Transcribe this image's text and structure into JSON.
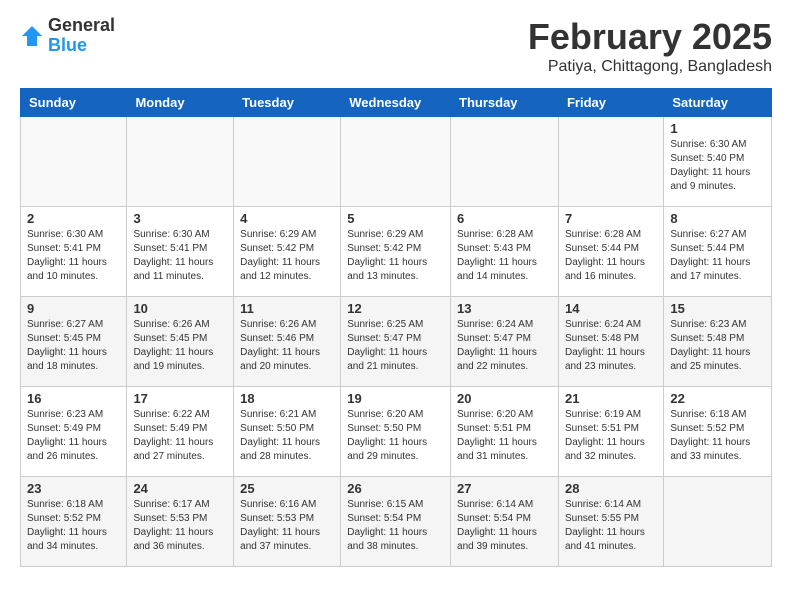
{
  "logo": {
    "general": "General",
    "blue": "Blue"
  },
  "title": "February 2025",
  "subtitle": "Patiya, Chittagong, Bangladesh",
  "days_of_week": [
    "Sunday",
    "Monday",
    "Tuesday",
    "Wednesday",
    "Thursday",
    "Friday",
    "Saturday"
  ],
  "weeks": [
    [
      {
        "day": "",
        "info": ""
      },
      {
        "day": "",
        "info": ""
      },
      {
        "day": "",
        "info": ""
      },
      {
        "day": "",
        "info": ""
      },
      {
        "day": "",
        "info": ""
      },
      {
        "day": "",
        "info": ""
      },
      {
        "day": "1",
        "info": "Sunrise: 6:30 AM\nSunset: 5:40 PM\nDaylight: 11 hours\nand 9 minutes."
      }
    ],
    [
      {
        "day": "2",
        "info": "Sunrise: 6:30 AM\nSunset: 5:41 PM\nDaylight: 11 hours\nand 10 minutes."
      },
      {
        "day": "3",
        "info": "Sunrise: 6:30 AM\nSunset: 5:41 PM\nDaylight: 11 hours\nand 11 minutes."
      },
      {
        "day": "4",
        "info": "Sunrise: 6:29 AM\nSunset: 5:42 PM\nDaylight: 11 hours\nand 12 minutes."
      },
      {
        "day": "5",
        "info": "Sunrise: 6:29 AM\nSunset: 5:42 PM\nDaylight: 11 hours\nand 13 minutes."
      },
      {
        "day": "6",
        "info": "Sunrise: 6:28 AM\nSunset: 5:43 PM\nDaylight: 11 hours\nand 14 minutes."
      },
      {
        "day": "7",
        "info": "Sunrise: 6:28 AM\nSunset: 5:44 PM\nDaylight: 11 hours\nand 16 minutes."
      },
      {
        "day": "8",
        "info": "Sunrise: 6:27 AM\nSunset: 5:44 PM\nDaylight: 11 hours\nand 17 minutes."
      }
    ],
    [
      {
        "day": "9",
        "info": "Sunrise: 6:27 AM\nSunset: 5:45 PM\nDaylight: 11 hours\nand 18 minutes."
      },
      {
        "day": "10",
        "info": "Sunrise: 6:26 AM\nSunset: 5:45 PM\nDaylight: 11 hours\nand 19 minutes."
      },
      {
        "day": "11",
        "info": "Sunrise: 6:26 AM\nSunset: 5:46 PM\nDaylight: 11 hours\nand 20 minutes."
      },
      {
        "day": "12",
        "info": "Sunrise: 6:25 AM\nSunset: 5:47 PM\nDaylight: 11 hours\nand 21 minutes."
      },
      {
        "day": "13",
        "info": "Sunrise: 6:24 AM\nSunset: 5:47 PM\nDaylight: 11 hours\nand 22 minutes."
      },
      {
        "day": "14",
        "info": "Sunrise: 6:24 AM\nSunset: 5:48 PM\nDaylight: 11 hours\nand 23 minutes."
      },
      {
        "day": "15",
        "info": "Sunrise: 6:23 AM\nSunset: 5:48 PM\nDaylight: 11 hours\nand 25 minutes."
      }
    ],
    [
      {
        "day": "16",
        "info": "Sunrise: 6:23 AM\nSunset: 5:49 PM\nDaylight: 11 hours\nand 26 minutes."
      },
      {
        "day": "17",
        "info": "Sunrise: 6:22 AM\nSunset: 5:49 PM\nDaylight: 11 hours\nand 27 minutes."
      },
      {
        "day": "18",
        "info": "Sunrise: 6:21 AM\nSunset: 5:50 PM\nDaylight: 11 hours\nand 28 minutes."
      },
      {
        "day": "19",
        "info": "Sunrise: 6:20 AM\nSunset: 5:50 PM\nDaylight: 11 hours\nand 29 minutes."
      },
      {
        "day": "20",
        "info": "Sunrise: 6:20 AM\nSunset: 5:51 PM\nDaylight: 11 hours\nand 31 minutes."
      },
      {
        "day": "21",
        "info": "Sunrise: 6:19 AM\nSunset: 5:51 PM\nDaylight: 11 hours\nand 32 minutes."
      },
      {
        "day": "22",
        "info": "Sunrise: 6:18 AM\nSunset: 5:52 PM\nDaylight: 11 hours\nand 33 minutes."
      }
    ],
    [
      {
        "day": "23",
        "info": "Sunrise: 6:18 AM\nSunset: 5:52 PM\nDaylight: 11 hours\nand 34 minutes."
      },
      {
        "day": "24",
        "info": "Sunrise: 6:17 AM\nSunset: 5:53 PM\nDaylight: 11 hours\nand 36 minutes."
      },
      {
        "day": "25",
        "info": "Sunrise: 6:16 AM\nSunset: 5:53 PM\nDaylight: 11 hours\nand 37 minutes."
      },
      {
        "day": "26",
        "info": "Sunrise: 6:15 AM\nSunset: 5:54 PM\nDaylight: 11 hours\nand 38 minutes."
      },
      {
        "day": "27",
        "info": "Sunrise: 6:14 AM\nSunset: 5:54 PM\nDaylight: 11 hours\nand 39 minutes."
      },
      {
        "day": "28",
        "info": "Sunrise: 6:14 AM\nSunset: 5:55 PM\nDaylight: 11 hours\nand 41 minutes."
      },
      {
        "day": "",
        "info": ""
      }
    ]
  ]
}
